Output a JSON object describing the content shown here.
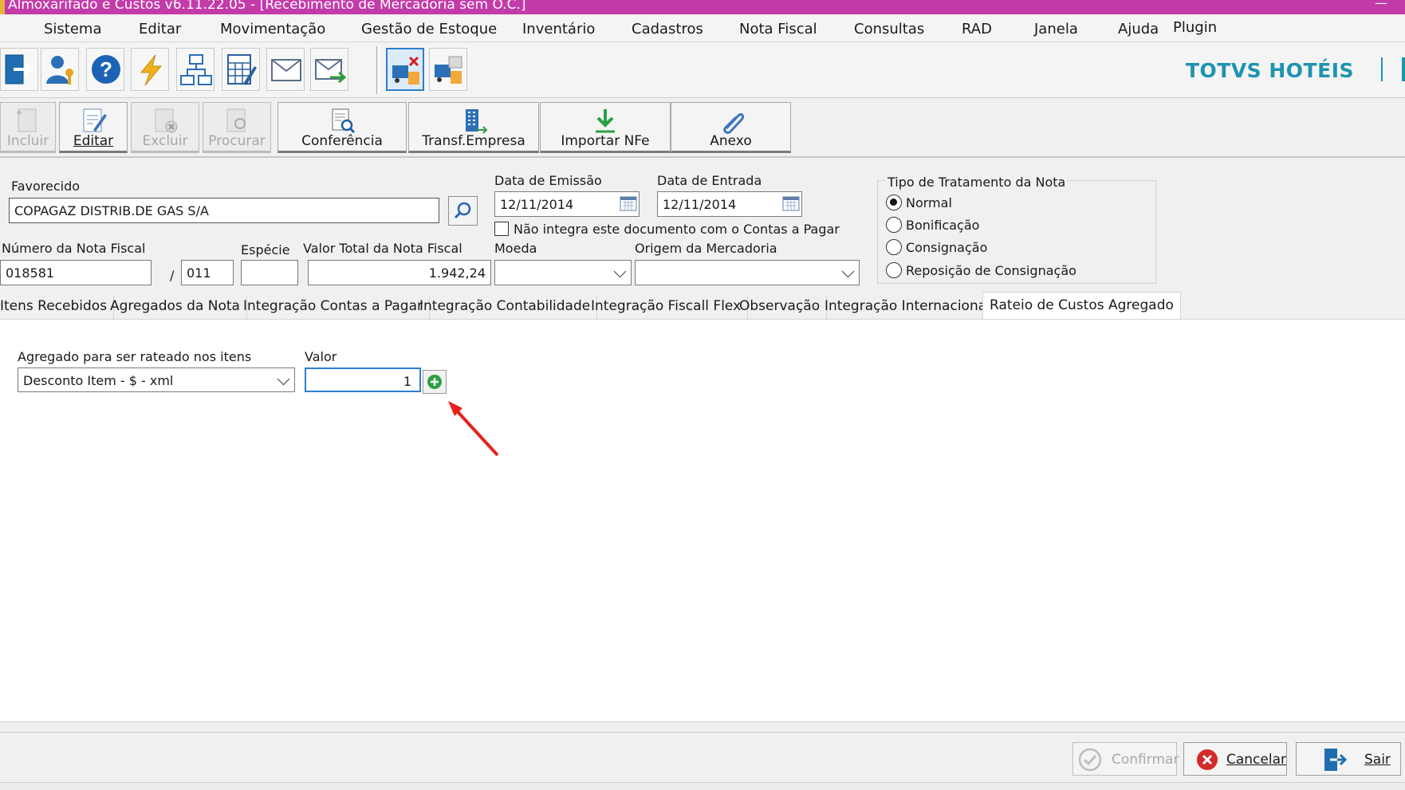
{
  "window": {
    "title": "Almoxarifado e Custos v6.11.22.05 - [Recebimento de Mercadoria sem O.C.]",
    "minimize_glyph": "—"
  },
  "menu": [
    "Sistema",
    "Editar",
    "Movimentação",
    "Gestão de Estoque",
    "Inventário",
    "Cadastros",
    "Nota Fiscal",
    "Consultas",
    "RAD",
    "Janela",
    "Ajuda",
    "Plugin"
  ],
  "toolbar_icons": [
    "exit-icon",
    "user-key-icon",
    "help-icon",
    "lightning-icon",
    "network-icon",
    "calculator-edit-icon",
    "mail-icon",
    "mail-forward-icon",
    "truck-cancel-icon",
    "truck-boxes-icon"
  ],
  "brand": "TOTVS HOTÉIS",
  "actions": {
    "incluir": "Incluir",
    "editar": "Editar",
    "excluir": "Excluir",
    "procurar": "Procurar",
    "conferencia": "Conferência",
    "transf_empresa": "Transf.Empresa",
    "importar_nfe": "Importar NFe",
    "anexo": "Anexo"
  },
  "form": {
    "favorecido_label": "Favorecido",
    "favorecido_value": "COPAGAZ DISTRIB.DE GAS S/A",
    "data_emissao_label": "Data de Emissão",
    "data_emissao_value": "12/11/2014",
    "data_entrada_label": "Data de Entrada",
    "data_entrada_value": "12/11/2014",
    "nao_integra_label": "Não integra este documento com o Contas a Pagar",
    "nao_integra_checked": false,
    "numero_nf_label": "Número da Nota Fiscal",
    "numero_nf_value": "018581",
    "serie_sep": "/",
    "serie_value": "011",
    "especie_label": "Espécie",
    "especie_value": "",
    "valor_total_label": "Valor Total da Nota Fiscal",
    "valor_total_value": "1.942,24",
    "moeda_label": "Moeda",
    "moeda_value": "",
    "origem_label": "Origem da Mercadoria",
    "origem_value": ""
  },
  "tratamento": {
    "label": "Tipo de Tratamento da Nota",
    "options": [
      "Normal",
      "Bonificação",
      "Consignação",
      "Reposição de Consignação"
    ],
    "selected": "Normal"
  },
  "tabs": [
    "Itens Recebidos",
    "Agregados da Nota",
    "Integração Contas a Pagar",
    "Integração Contabilidade",
    "Integração Fiscall Flex",
    "Observação",
    "Integração Internacional",
    "Rateio de Custos Agregado"
  ],
  "active_tab": "Rateio de Custos Agregado",
  "rateio": {
    "agregado_label": "Agregado para ser rateado nos itens",
    "agregado_value": "Desconto Item - $ - xml",
    "valor_label": "Valor",
    "valor_value": "1"
  },
  "footer": {
    "confirmar": "Confirmar",
    "cancelar": "Cancelar",
    "sair": "Sair"
  },
  "colors": {
    "titlebar": "#c33ba8",
    "brand": "#1e93b0",
    "annotation_arrow": "#e8201c"
  }
}
